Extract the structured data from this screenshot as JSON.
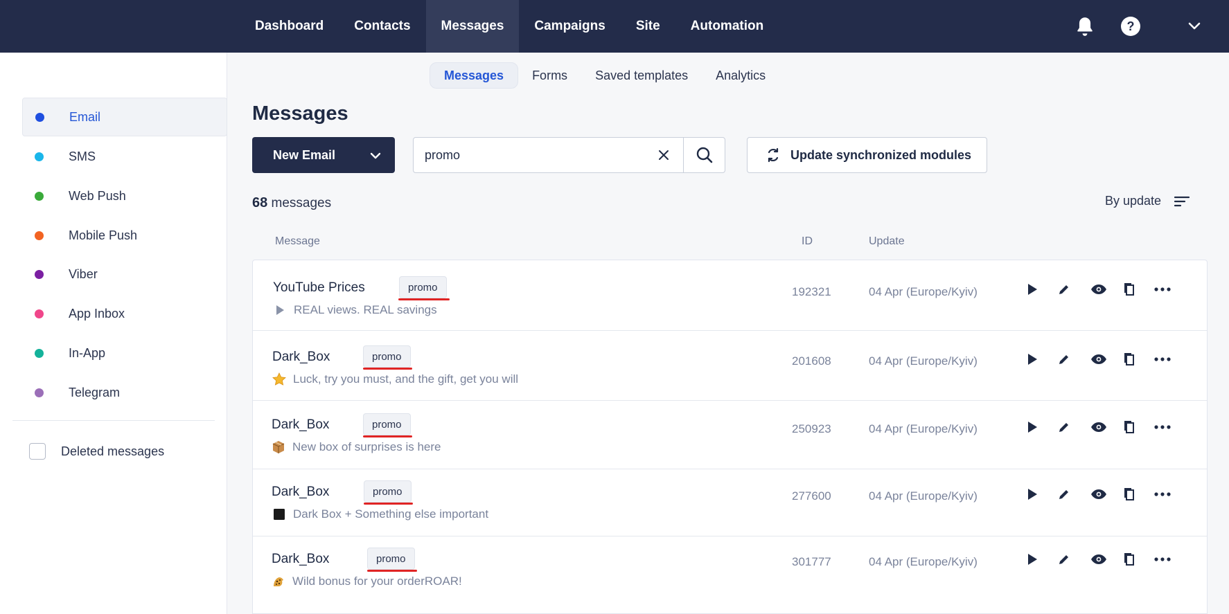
{
  "topnav": {
    "items": [
      {
        "label": "Dashboard"
      },
      {
        "label": "Contacts"
      },
      {
        "label": "Messages"
      },
      {
        "label": "Campaigns"
      },
      {
        "label": "Site"
      },
      {
        "label": "Automation"
      }
    ],
    "active": "Messages",
    "icons": [
      "bell-icon",
      "help-icon",
      "chevron-down-icon"
    ]
  },
  "subtabs": [
    {
      "label": "Messages"
    },
    {
      "label": "Forms"
    },
    {
      "label": "Saved templates"
    },
    {
      "label": "Analytics"
    }
  ],
  "sidebar": {
    "items": [
      {
        "label": "Email",
        "color": "#1f4fe0"
      },
      {
        "label": "SMS",
        "color": "#1ab6ea"
      },
      {
        "label": "Web Push",
        "color": "#3aaa3a"
      },
      {
        "label": "Mobile Push",
        "color": "#f26322"
      },
      {
        "label": "Viber",
        "color": "#7b1fa2"
      },
      {
        "label": "App Inbox",
        "color": "#f0468a"
      },
      {
        "label": "In-App",
        "color": "#14b29a"
      },
      {
        "label": "Telegram",
        "color": "#9b6fb8"
      }
    ],
    "deleted_label": "Deleted messages"
  },
  "main": {
    "title": "Messages",
    "new_email_label": "New Email",
    "search": {
      "value": "promo"
    },
    "update_label": "Update synchronized modules",
    "count": "68",
    "count_suffix": "messages",
    "sort_label": "By update",
    "columns": {
      "message": "Message",
      "id": "ID",
      "update": "Update"
    }
  },
  "rows": [
    {
      "title": "YouTube Prices",
      "tag": "promo",
      "subject": "REAL views. REAL savings",
      "subject_icon": "play-triangle-icon",
      "id": "192321",
      "date": "04 Apr (Europe/Kyiv)"
    },
    {
      "title": "Dark_Box",
      "tag": "promo",
      "subject": "Luck, try you must, and the gift, get you will",
      "subject_icon": "star-emoji-icon",
      "id": "201608",
      "date": "04 Apr (Europe/Kyiv)"
    },
    {
      "title": "Dark_Box",
      "tag": "promo",
      "subject": "New box of surprises is here",
      "subject_icon": "package-emoji-icon",
      "id": "250923",
      "date": "04 Apr (Europe/Kyiv)"
    },
    {
      "title": "Dark_Box",
      "tag": "promo",
      "subject": "Dark Box + Something else important",
      "subject_icon": "black-square-emoji-icon",
      "id": "277600",
      "date": "04 Apr (Europe/Kyiv)"
    },
    {
      "title": "Dark_Box",
      "tag": "promo",
      "subject": "Wild bonus for your orderROAR!",
      "subject_icon": "leopard-emoji-icon",
      "id": "301777",
      "date": "04 Apr (Europe/Kyiv)"
    }
  ],
  "row_actions": [
    "play-icon",
    "edit-pencil-icon",
    "preview-eye-icon",
    "copy-icon",
    "more-dots-icon"
  ],
  "colors": {
    "nav_bg": "#232c4a",
    "accent": "#2456d6",
    "tag_underline": "#e02424"
  }
}
